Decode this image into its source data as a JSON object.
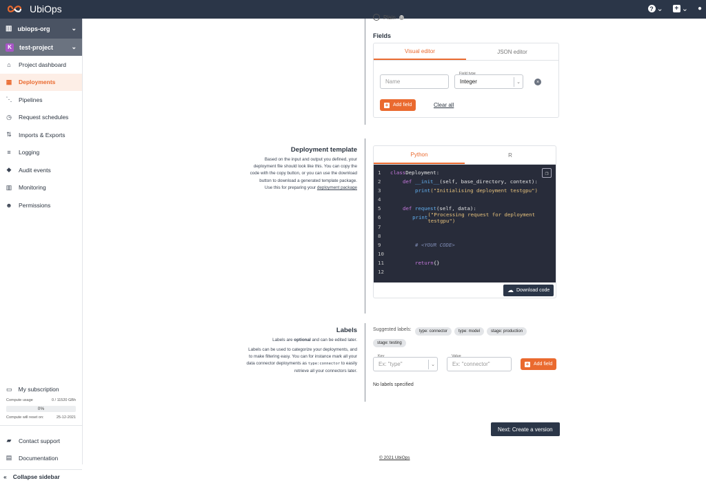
{
  "app": {
    "name": "UbiOps"
  },
  "topbar": {
    "help_icon": "question-icon",
    "add_icon": "plus-box-icon",
    "user_icon": "user-icon"
  },
  "sidebar": {
    "org": "ubiops-org",
    "project": "test-project",
    "project_initial": "K",
    "items": [
      {
        "label": "Project dashboard",
        "icon": "home-icon",
        "active": false
      },
      {
        "label": "Deployments",
        "icon": "grid-icon",
        "active": true
      },
      {
        "label": "Pipelines",
        "icon": "pipeline-icon",
        "active": false
      },
      {
        "label": "Request schedules",
        "icon": "clock-icon",
        "active": false
      },
      {
        "label": "Imports & Exports",
        "icon": "import-export-icon",
        "active": false
      },
      {
        "label": "Logging",
        "icon": "list-icon",
        "active": false
      },
      {
        "label": "Audit events",
        "icon": "box-icon",
        "active": false
      },
      {
        "label": "Monitoring",
        "icon": "chart-icon",
        "active": false
      },
      {
        "label": "Permissions",
        "icon": "users-icon",
        "active": false
      }
    ],
    "subscription": {
      "label": "My subscription",
      "usage_label": "Compute usage",
      "usage_value": "0 / 11520 GBh",
      "usage_percent": "0%",
      "reset_label": "Compute will reset on:",
      "reset_date": "25-12-2021"
    },
    "contact": "Contact support",
    "docs": "Documentation",
    "collapse": "Collapse sidebar"
  },
  "output": {
    "radio_label": "Plain",
    "fields_title": "Fields",
    "tabs": [
      "Visual editor",
      "JSON editor"
    ],
    "name_placeholder": "Name",
    "field_type_label": "Field type",
    "field_type_value": "Integer",
    "add_field": "Add field",
    "clear_all": "Clear all"
  },
  "template": {
    "title": "Deployment template",
    "desc_lines": [
      "Based on the input and output you defined, your",
      "deployment file should look like this. You can copy the",
      "code with the copy button, or you can use the download",
      "button to download a generated template package.",
      "Use this for preparing your"
    ],
    "desc_link": "deployment package",
    "tabs": [
      "Python",
      "R"
    ],
    "code_numbers": [
      "1",
      "2",
      "3",
      "4",
      "5",
      "6",
      "7",
      "8",
      "9",
      "10",
      "11",
      "12"
    ],
    "code": {
      "l1a": "class",
      "l1b": " Deployment:",
      "l2a": "def",
      "l2b": "__init__",
      "l2c": "(self, base_directory, context):",
      "l3a": "print",
      "l3b": "(\"Initialising deployment testgpu\")",
      "l5a": "def",
      "l5b": "request",
      "l5c": "(self, data):",
      "l6a": "print",
      "l6b": "(\"Processing request for deployment testgpu\")",
      "l9": "# <YOUR CODE>",
      "l11a": "return",
      "l11b": " {}"
    },
    "download": "Download code"
  },
  "labels": {
    "title": "Labels",
    "optional_pre": "Labels are ",
    "optional_bold": "optional",
    "optional_post": " and can be edited later.",
    "desc_lines": [
      "Labels can be used to categorize your deployments, and",
      "to make filtering easy. You can for instance mark all your",
      "retrieve all your connectors later."
    ],
    "desc_line3_pre": "data connector deployments as",
    "desc_line3_code": "type:connector",
    "desc_line3_post": "to easily",
    "suggested": "Suggested labels:",
    "chips": [
      "type: connector",
      "type: model",
      "stage: production",
      "stage: testing"
    ],
    "key_label": "Key",
    "key_placeholder": "Ex: \"type\"",
    "value_label": "Value",
    "value_placeholder": "Ex: \"connector\"",
    "add_field": "Add field",
    "none": "No labels specified"
  },
  "next_button": "Next: Create a version",
  "footer": "© 2021 UbiOps"
}
